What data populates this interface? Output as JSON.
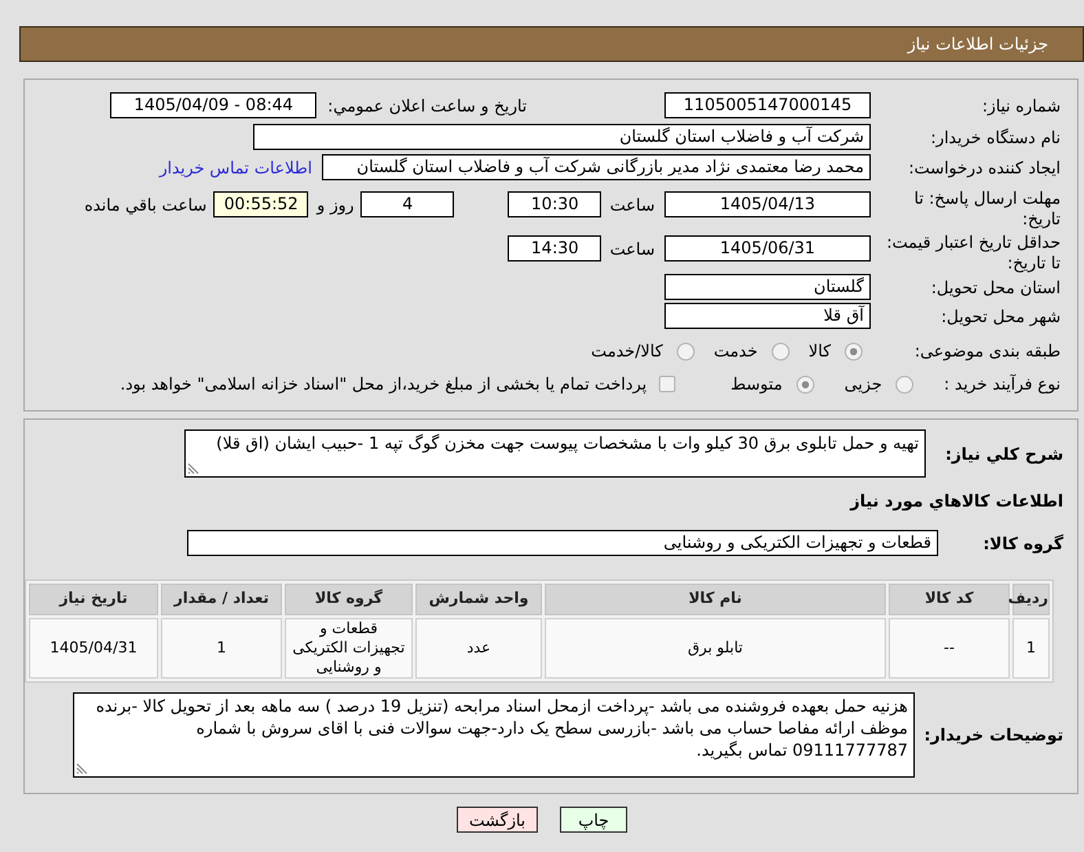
{
  "header": {
    "title": "جزئیات اطلاعات نیاز"
  },
  "details": {
    "need_number": {
      "label": "شماره نیاز:",
      "value": "1105005147000145"
    },
    "announce": {
      "label": "تاریخ و ساعت اعلان عمومي:",
      "value": "1405/04/09 - 08:44"
    },
    "buyer_org": {
      "label": "نام دستگاه خریدار:",
      "value": "شرکت آب و فاضلاب استان گلستان"
    },
    "requester": {
      "label": "ایجاد کننده درخواست:",
      "value": "محمد رضا معتمدی نژاد مدیر بازرگانی شرکت آب و فاضلاب استان گلستان",
      "link": "اطلاعات تماس خریدار"
    },
    "deadline": {
      "label": "مهلت ارسال پاسخ: تا تاریخ:",
      "date": "1405/04/13",
      "time_label": "ساعت",
      "time": "10:30",
      "days": "4",
      "days_label": "روز و",
      "remaining": "00:55:52",
      "remaining_label": "ساعت باقي مانده"
    },
    "validity": {
      "label": "حداقل تاریخ اعتبار قیمت: تا تاریخ:",
      "date": "1405/06/31",
      "time_label": "ساعت",
      "time": "14:30"
    },
    "province": {
      "label": "استان محل تحویل:",
      "value": "گلستان"
    },
    "city": {
      "label": "شهر محل تحویل:",
      "value": "آق قلا"
    },
    "category": {
      "label": "طبقه بندی موضوعی:",
      "options": [
        {
          "label": "کالا",
          "selected": true
        },
        {
          "label": "خدمت",
          "selected": false
        },
        {
          "label": "کالا/خدمت",
          "selected": false
        }
      ]
    },
    "process": {
      "label": "نوع فرآیند خرید :",
      "options": [
        {
          "label": "جزیی",
          "selected": false
        },
        {
          "label": "متوسط",
          "selected": true
        }
      ],
      "treasury": {
        "label": "پرداخت تمام یا بخشی از مبلغ خرید،از محل \"اسناد خزانه اسلامی\" خواهد بود.",
        "checked": false
      }
    }
  },
  "description": {
    "label": "شرح کلي نیاز:",
    "value": "تهیه و حمل تابلوی برق 30 کیلو وات با مشخصات پیوست جهت مخزن گوگ تپه 1 -حبیب ایشان (اق قلا)"
  },
  "items": {
    "title": "اطلاعات کالاهاي مورد نیاز",
    "group_label": "گروه کالا:",
    "group_value": "قطعات و تجهیزات الکتریکی و روشنایی",
    "table": {
      "columns": [
        "ردیف",
        "کد کالا",
        "نام کالا",
        "واحد شمارش",
        "گروه کالا",
        "تعداد / مقدار",
        "تاریخ نیاز"
      ],
      "rows": [
        [
          "1",
          "--",
          "تابلو برق",
          "عدد",
          "قطعات و تجهیزات الکتریکی و روشنایی",
          "1",
          "1405/04/31"
        ]
      ]
    }
  },
  "buyer_notes": {
    "label": "توضیحات خریدار:",
    "value": "هزنیه حمل بعهده فروشنده می باشد -پرداخت ازمحل اسناد مرابحه (تنزیل 19 درصد ) سه ماهه بعد از تحویل کالا -برنده موظف ارائه مفاصا حساب می باشد -بازرسی سطح یک دارد-جهت سوالات فنی با اقای سروش با شماره 09111777787 تماس بگیرید."
  },
  "buttons": [
    {
      "label": "چاپ",
      "kind": "print"
    },
    {
      "label": "بازگشت",
      "kind": "back"
    }
  ]
}
